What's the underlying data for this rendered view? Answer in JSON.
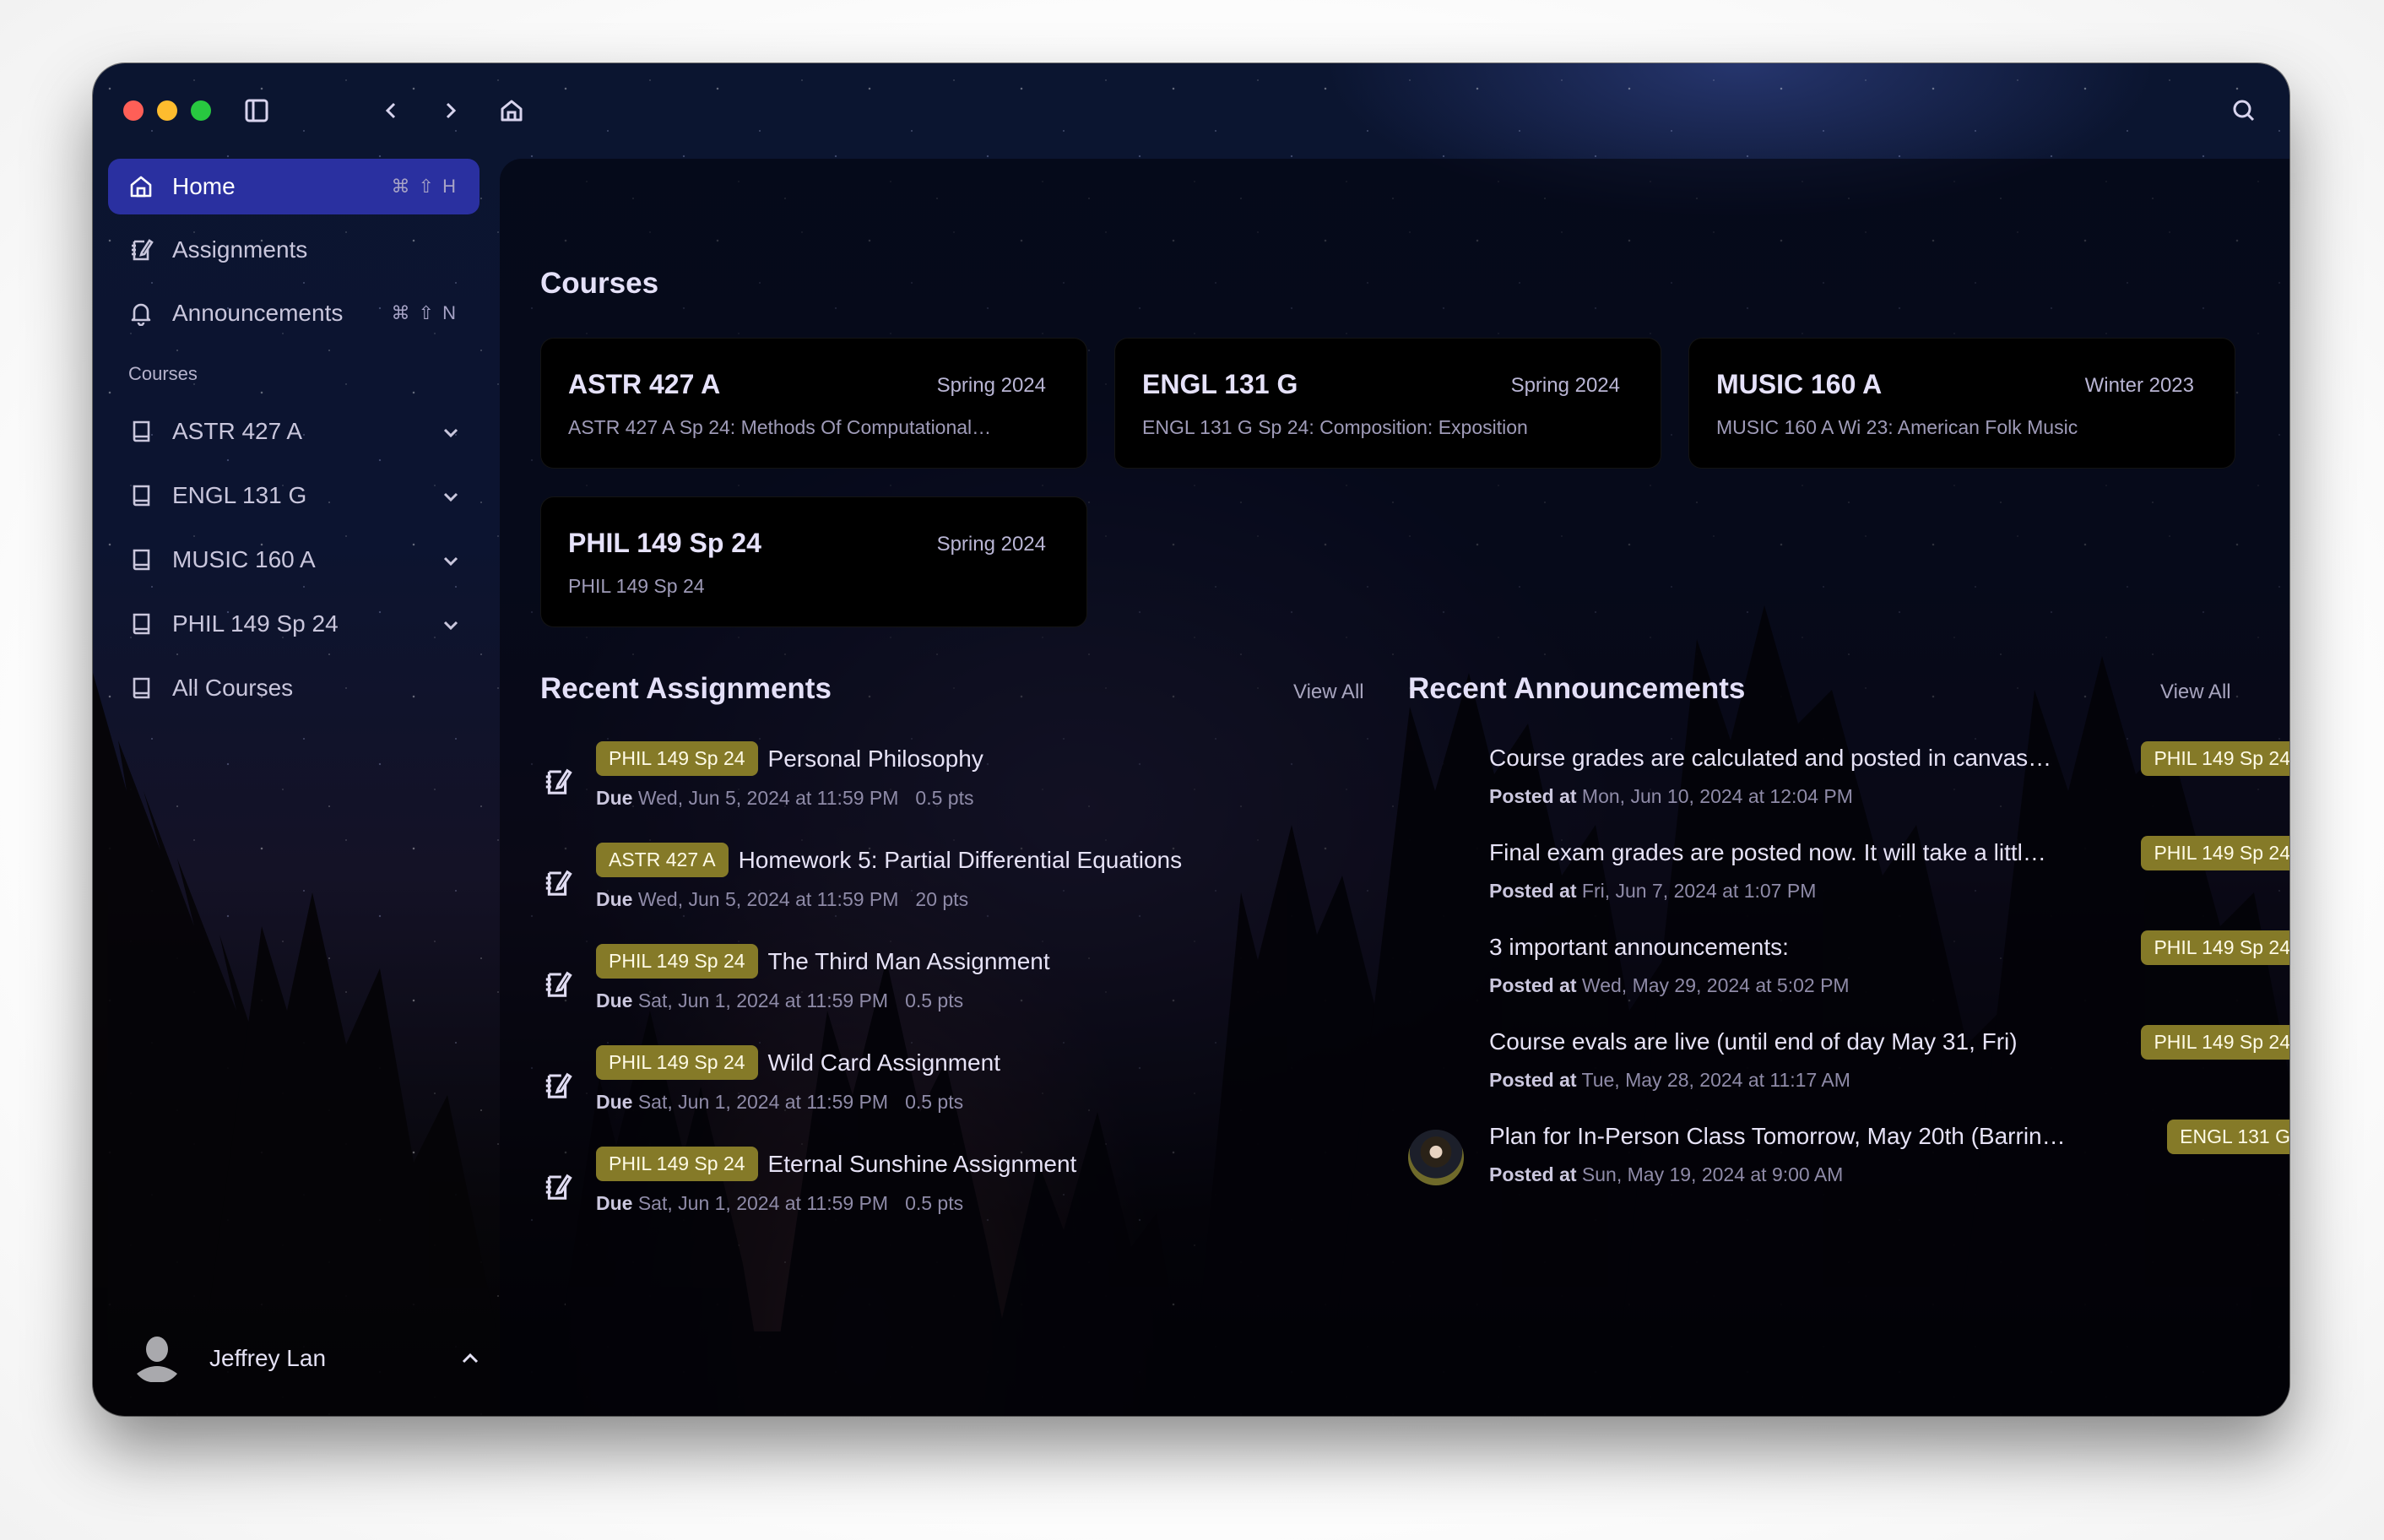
{
  "window": {
    "toolbar": {
      "sidebar_toggle_icon": "sidebar-icon",
      "back_icon": "chevron-left-icon",
      "forward_icon": "chevron-right-icon",
      "home_icon": "home-icon",
      "search_icon": "search-icon"
    }
  },
  "sidebar": {
    "nav": [
      {
        "label": "Home",
        "icon": "home-icon",
        "shortcut": "⌘ ⇧ H",
        "active": true
      },
      {
        "label": "Assignments",
        "icon": "assignment-notebook-icon",
        "shortcut": ""
      },
      {
        "label": "Announcements",
        "icon": "bell-icon",
        "shortcut": "⌘ ⇧ N"
      }
    ],
    "courses_label": "Courses",
    "courses": [
      {
        "label": "ASTR 427 A",
        "icon": "book-icon",
        "expandable": true
      },
      {
        "label": "ENGL 131 G",
        "icon": "book-icon",
        "expandable": true
      },
      {
        "label": "MUSIC 160 A",
        "icon": "book-icon",
        "expandable": true
      },
      {
        "label": "PHIL 149 Sp 24",
        "icon": "book-icon",
        "expandable": true
      },
      {
        "label": "All Courses",
        "icon": "book-icon",
        "expandable": false
      }
    ],
    "user": {
      "name": "Jeffrey Lan"
    }
  },
  "main": {
    "courses_heading": "Courses",
    "course_cards": [
      {
        "code": "ASTR 427 A",
        "term": "Spring 2024",
        "description": "ASTR 427 A Sp 24: Methods Of Computational…"
      },
      {
        "code": "ENGL 131 G",
        "term": "Spring 2024",
        "description": "ENGL 131 G Sp 24: Composition: Exposition"
      },
      {
        "code": "MUSIC 160 A",
        "term": "Winter 2023",
        "description": "MUSIC 160 A Wi 23: American Folk Music"
      },
      {
        "code": "PHIL 149 Sp 24",
        "term": "Spring 2024",
        "description": "PHIL 149 Sp 24"
      }
    ],
    "assignments": {
      "heading": "Recent Assignments",
      "view_all": "View All",
      "due_label": "Due",
      "items": [
        {
          "course": "PHIL 149 Sp 24",
          "title": "Personal Philosophy",
          "due": "Wed, Jun 5, 2024 at 11:59 PM",
          "points": "0.5 pts"
        },
        {
          "course": "ASTR 427 A",
          "title": "Homework 5: Partial Differential Equations",
          "due": "Wed, Jun 5, 2024 at 11:59 PM",
          "points": "20 pts"
        },
        {
          "course": "PHIL 149 Sp 24",
          "title": "The Third Man Assignment",
          "due": "Sat, Jun 1, 2024 at 11:59 PM",
          "points": "0.5 pts"
        },
        {
          "course": "PHIL 149 Sp 24",
          "title": "Wild Card Assignment",
          "due": "Sat, Jun 1, 2024 at 11:59 PM",
          "points": "0.5 pts"
        },
        {
          "course": "PHIL 149 Sp 24",
          "title": "Eternal Sunshine Assignment",
          "due": "Sat, Jun 1, 2024 at 11:59 PM",
          "points": "0.5 pts"
        }
      ]
    },
    "announcements": {
      "heading": "Recent Announcements",
      "view_all": "View All",
      "posted_label": "Posted at",
      "items": [
        {
          "title": "Course grades are calculated and posted in canvas…",
          "posted": "Mon, Jun 10, 2024 at 12:04 PM",
          "course": "PHIL 149 Sp 24",
          "has_avatar": false
        },
        {
          "title": "Final exam grades are posted now. It will take a littl…",
          "posted": "Fri, Jun 7, 2024 at 1:07 PM",
          "course": "PHIL 149 Sp 24",
          "has_avatar": false
        },
        {
          "title": "3 important announcements:",
          "posted": "Wed, May 29, 2024 at 5:02 PM",
          "course": "PHIL 149 Sp 24",
          "has_avatar": false
        },
        {
          "title": "Course evals are live (until end of day May 31, Fri)",
          "posted": "Tue, May 28, 2024 at 11:17 AM",
          "course": "PHIL 149 Sp 24",
          "has_avatar": false
        },
        {
          "title": "Plan for In-Person Class Tomorrow, May 20th (Barring…",
          "posted": "Sun, May 19, 2024 at 9:00 AM",
          "course": "ENGL 131 G",
          "has_avatar": true
        }
      ]
    }
  },
  "colors": {
    "active_nav": "#2a30a0",
    "course_badge": "#857a28",
    "traffic_red": "#ff5f57",
    "traffic_yellow": "#febc2e",
    "traffic_green": "#28c840"
  }
}
